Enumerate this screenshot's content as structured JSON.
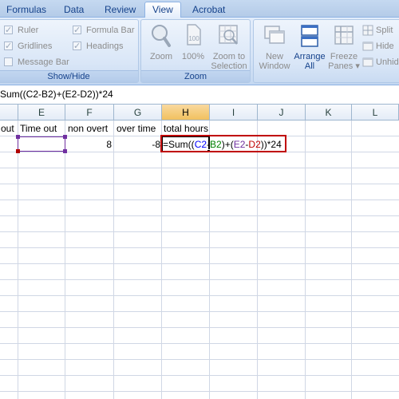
{
  "tabs": [
    "Formulas",
    "Data",
    "Review",
    "View",
    "Acrobat"
  ],
  "showhide": {
    "label": "Show/Hide",
    "ruler": "Ruler",
    "gridlines": "Gridlines",
    "message_bar": "Message Bar",
    "formula_bar": "Formula Bar",
    "headings": "Headings"
  },
  "zoom_group": {
    "label": "Zoom",
    "zoom": "Zoom",
    "zoom100": "100%",
    "zoom_sel_1": "Zoom to",
    "zoom_sel_2": "Selection"
  },
  "window_group": {
    "new_window_1": "New",
    "new_window_2": "Window",
    "arrange_1": "Arrange",
    "arrange_2": "All",
    "freeze_1": "Freeze",
    "freeze_2": "Panes ▾",
    "split": "Split",
    "hide": "Hide",
    "unhide": "Unhid"
  },
  "formula_bar": {
    "text": "Sum((C2-B2)+(E2-D2))*24"
  },
  "columns": [
    "E",
    "F",
    "G",
    "H",
    "I",
    "J",
    "K",
    "L"
  ],
  "selected_column": "H",
  "row1": {
    "d": "out",
    "e": "Time out",
    "f": "non overt",
    "g": "over time",
    "h": "total hours"
  },
  "row2": {
    "f": "8",
    "g": "-8"
  },
  "cell_formula": {
    "p1": "=Sum((",
    "c2": "C2",
    "minus1": "-",
    "b2": "B2",
    "p2": ")+(",
    "e2": "E2",
    "minus2": "-",
    "d2": "D2",
    "p3": "))*24"
  },
  "colors": {
    "ref_c2": "#0000ff",
    "ref_b2": "#008000",
    "ref_e2": "#7030a0",
    "ref_d2": "#c00000",
    "active_border": "#c00000",
    "selected_header": "#f1c15f"
  }
}
